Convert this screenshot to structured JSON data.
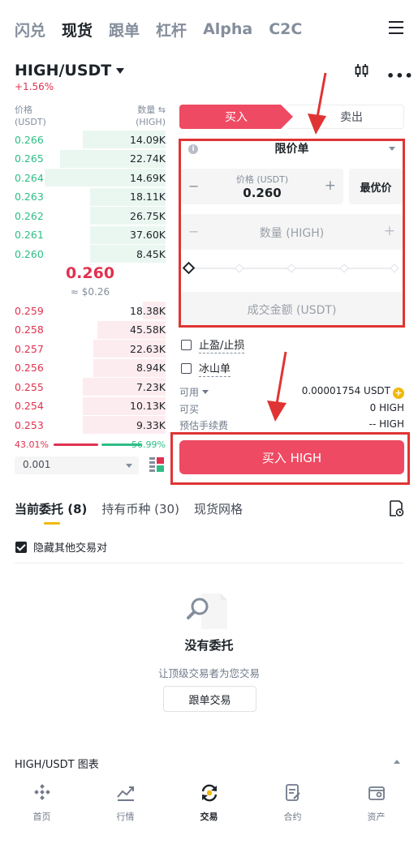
{
  "nav": {
    "tabs": [
      "闪兑",
      "现货",
      "跟单",
      "杠杆",
      "Alpha",
      "C2C"
    ],
    "active_index": 1
  },
  "pair": {
    "name": "HIGH/USDT",
    "change": "+1.56%"
  },
  "orderbook": {
    "price_header": "价格",
    "price_unit": "(USDT)",
    "qty_header": "数量 ⇆",
    "qty_unit": "(HIGH)",
    "buys": [
      {
        "price": "0.266",
        "qty": "14.09K",
        "depth": 0.55
      },
      {
        "price": "0.265",
        "qty": "22.74K",
        "depth": 0.7
      },
      {
        "price": "0.264",
        "qty": "14.69K",
        "depth": 0.8
      },
      {
        "price": "0.263",
        "qty": "18.11K",
        "depth": 0.5
      },
      {
        "price": "0.262",
        "qty": "26.75K",
        "depth": 0.5
      },
      {
        "price": "0.261",
        "qty": "37.60K",
        "depth": 0.5
      },
      {
        "price": "0.260",
        "qty": "8.45K",
        "depth": 0.5
      }
    ],
    "mid_price": "0.260",
    "mid_usd": "≈ $0.26",
    "sells": [
      {
        "price": "0.259",
        "qty": "18.38K",
        "depth": 0.15
      },
      {
        "price": "0.258",
        "qty": "45.58K",
        "depth": 0.45
      },
      {
        "price": "0.257",
        "qty": "22.63K",
        "depth": 0.48
      },
      {
        "price": "0.256",
        "qty": "8.94K",
        "depth": 0.48
      },
      {
        "price": "0.255",
        "qty": "7.23K",
        "depth": 0.55
      },
      {
        "price": "0.254",
        "qty": "10.13K",
        "depth": 0.55
      },
      {
        "price": "0.253",
        "qty": "9.33K",
        "depth": 0.55
      }
    ],
    "sell_ratio": "43.01%",
    "buy_ratio": "56.99%",
    "precision": "0.001"
  },
  "trade": {
    "buy_tab": "买入",
    "sell_tab": "卖出",
    "order_type": "限价单",
    "price_label": "价格 (USDT)",
    "price_value": "0.260",
    "best_price": "最优价",
    "qty_placeholder": "数量 (HIGH)",
    "total_placeholder": "成交金额 (USDT)",
    "tp_sl": "止盈/止损",
    "iceberg": "冰山单",
    "available_label": "可用",
    "available_value": "0.00001754 USDT",
    "can_buy_label": "可买",
    "can_buy_value": "0 HIGH",
    "fee_label": "预估手续费",
    "fee_value": "-- HIGH",
    "buy_button": "买入 HIGH"
  },
  "bottom_tabs": {
    "open_orders": "当前委托 (8)",
    "holdings": "持有币种 (30)",
    "grid": "现货网格"
  },
  "hide_pairs": "隐藏其他交易对",
  "empty": {
    "title": "没有委托",
    "subtitle": "让顶级交易者为您交易",
    "button": "跟单交易"
  },
  "chart_toggle": "HIGH/USDT 图表",
  "bottom_nav": [
    {
      "label": "首页",
      "icon": "home-icon"
    },
    {
      "label": "行情",
      "icon": "markets-icon"
    },
    {
      "label": "交易",
      "icon": "trade-icon"
    },
    {
      "label": "合约",
      "icon": "futures-icon"
    },
    {
      "label": "资产",
      "icon": "wallet-icon"
    }
  ],
  "colors": {
    "buy": "#2ebd85",
    "sell": "#e0324f",
    "accent": "#f0b90b",
    "annotation": "#e03434"
  }
}
